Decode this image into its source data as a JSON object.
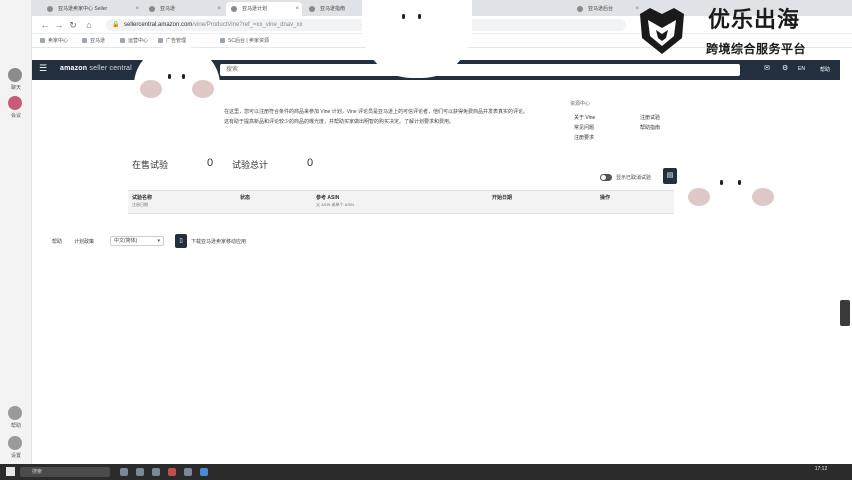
{
  "app_sidebar": {
    "items": [
      {
        "label": "聊天",
        "icon": "chat-icon"
      },
      {
        "label": "会议",
        "icon": "meeting-icon"
      },
      {
        "label": "帮助",
        "icon": "help-icon"
      },
      {
        "label": "设置",
        "icon": "gear-icon"
      }
    ]
  },
  "browser": {
    "tabs": [
      {
        "label": "亚马逊卖家中心 Seller"
      },
      {
        "label": "亚马逊"
      },
      {
        "label": "亚马逊计划"
      },
      {
        "label": "亚马逊指南"
      },
      {
        "label": "亚马逊后台"
      }
    ],
    "url_host": "sellercentral.amazon.com",
    "url_path": "/vine/ProductVine?ref_=xx_vine_dnav_xx",
    "bookmarks": [
      "卖家中心",
      "亚马逊",
      "运营中心",
      "广告管理",
      "SC后台 | 卖家资源"
    ]
  },
  "amazon_header": {
    "logo_brand": "amazon",
    "logo_sub": "seller central",
    "search_placeholder": "搜索",
    "language": "EN",
    "help": "帮助"
  },
  "intro": {
    "lines": [
      "在这里，您可以注册符合条件的商品来参加 Vine 计划，Vine 评论员是亚马逊上的可信评论者，他们可以获得免费商品并发表真实的评论。",
      "这有助于提高新品和评论较少的商品的曝光度，并帮助买家做出明智的购买决定。了解计划要求和费用。"
    ]
  },
  "resources": {
    "heading": "资源中心",
    "links": [
      "关于 Vine",
      "注册试验",
      "常见问题",
      "帮助指南",
      "注册要求"
    ]
  },
  "metrics": {
    "active_label": "在售试验",
    "active_value": "0",
    "total_label": "试验总计",
    "total_value": "0"
  },
  "filters": {
    "toggle_label": "显示已取消试验",
    "action_icon": "filter-icon"
  },
  "table": {
    "columns": [
      {
        "header": "试验名称",
        "sub": "注册日期"
      },
      {
        "header": "状态",
        "sub": ""
      },
      {
        "header": "参考 ASIN",
        "sub": "父 ASIN 或单个 ASIN"
      },
      {
        "header": "开始日期",
        "sub": ""
      },
      {
        "header": "操作",
        "sub": ""
      }
    ]
  },
  "footer": {
    "help": "帮助",
    "policy": "计划政策",
    "language": "中文(简体)",
    "app_promo": "下载亚马逊卖家移动应用"
  },
  "taskbar": {
    "search_placeholder": "搜索",
    "time": "17:12"
  },
  "watermark": {
    "title": "优乐出海",
    "subtitle": "跨境综合服务平台"
  }
}
